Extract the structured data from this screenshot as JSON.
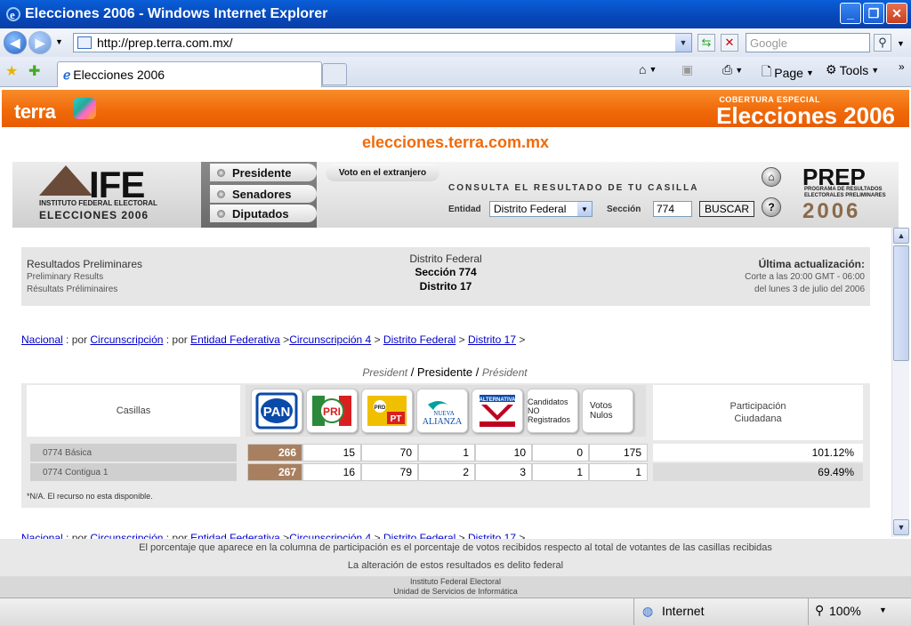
{
  "window": {
    "title": "Elecciones 2006 - Windows Internet Explorer"
  },
  "address": {
    "url": "http://prep.terra.com.mx/",
    "search_placeholder": "Google"
  },
  "tabs": [
    {
      "label": "Elecciones 2006"
    }
  ],
  "toolbar": {
    "page_label": "Page",
    "tools_label": "Tools"
  },
  "site": {
    "brand": "terra",
    "cobertura": "COBERTURA ESPECIAL",
    "elecciones": "Elecciones 2006",
    "url_text": "elecciones.terra.com.mx"
  },
  "ife": {
    "logo": "IFE",
    "sub1": "INSTITUTO FEDERAL ELECTORAL",
    "sub2": "ELECCIONES 2006",
    "nav": [
      "Presidente",
      "Senadores",
      "Diputados"
    ],
    "voto": "Voto en el extranjero",
    "consulta": "CONSULTA EL RESULTADO DE TU CASILLA",
    "entidad_label": "Entidad",
    "entidad_value": "Distrito Federal",
    "seccion_label": "Sección",
    "seccion_value": "774",
    "buscar": "BUSCAR",
    "prep": "PREP",
    "prep_sub": "PROGRAMA DE RESULTADOS ELECTORALES PRELIMINARES",
    "prep_year": "2006"
  },
  "info": {
    "title": "Resultados Preliminares",
    "en": "Preliminary Results",
    "fr": "Résultats Préliminaires",
    "entidad": "Distrito Federal",
    "seccion": "Sección 774",
    "distrito": "Distrito 17",
    "update_label": "Última actualización:",
    "update_time": "Corte a las 20:00 GMT - 06:00",
    "update_date": "del lunes 3 de julio del 2006"
  },
  "breadcrumb": {
    "nacional": "Nacional",
    "por1": " : por ",
    "circ": "Circunscripción",
    "por2": " : por ",
    "entidad": "Entidad Federativa",
    "sep1": " >",
    "circ4": "Circunscripción 4",
    "sep2": " > ",
    "df": "Distrito Federal",
    "sep3": " > ",
    "d17": "Distrito 17",
    "sep4": " >"
  },
  "election": {
    "en": "President",
    "sep1": " / ",
    "es": "Presidente",
    "sep2": " / ",
    "fr": "Président"
  },
  "table": {
    "casillas_header": "Casillas",
    "participacion_header": "Participación Ciudadana",
    "parties": [
      {
        "name": "PAN",
        "color": "#0a4aa8"
      },
      {
        "name": "PRI",
        "color": "#d92020"
      },
      {
        "name": "PRD PT",
        "color": "#f0c000"
      },
      {
        "name": "NUEVA ALIANZA",
        "color": "#00a0a0"
      },
      {
        "name": "ALTERNATIVA",
        "color": "#c00020"
      },
      {
        "name": "Candidatos NO Registrados",
        "color": "#ffffff"
      },
      {
        "name": "Votos Nulos",
        "color": "#ffffff"
      }
    ],
    "rows": [
      {
        "label": "0774 Básica",
        "values": [
          "266",
          "15",
          "70",
          "1",
          "10",
          "0",
          "175"
        ],
        "participacion": "101.12%"
      },
      {
        "label": "0774 Contigua 1",
        "values": [
          "267",
          "16",
          "79",
          "2",
          "3",
          "1",
          "1"
        ],
        "participacion": "69.49%"
      }
    ],
    "note": "*N/A. El recurso no esta disponible."
  },
  "footer": {
    "line1": "El porcentaje que aparece en la columna de participación es el porcentaje de votos recibidos respecto al total de votantes de las casillas recibidas",
    "line2": "La alteración de estos resultados es delito federal",
    "line3": "Instituto Federal Electoral",
    "line4": "Unidad de Servicios de Informática"
  },
  "status": {
    "zone": "Internet",
    "zoom": "100%"
  }
}
